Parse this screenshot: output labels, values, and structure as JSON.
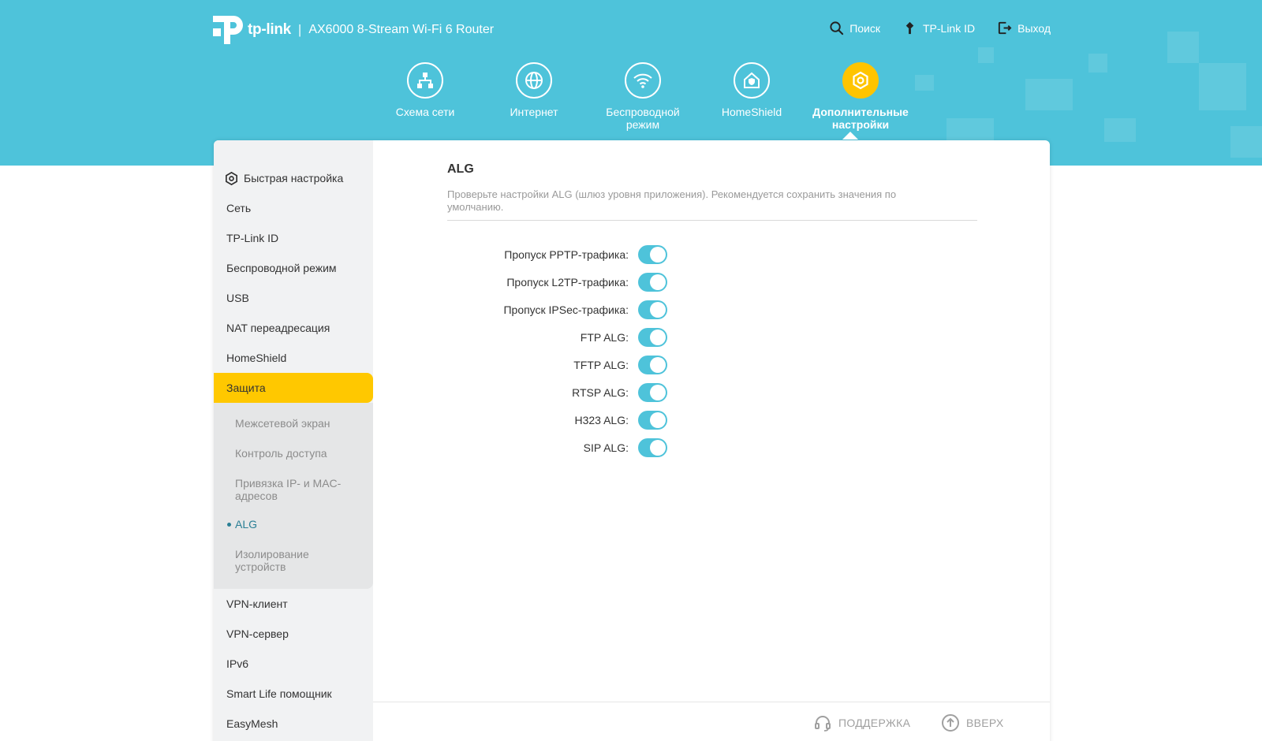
{
  "brand": {
    "logo_text": "tp-link",
    "separator": "|",
    "product": "AX6000 8-Stream Wi-Fi 6 Router"
  },
  "top_links": [
    {
      "label": "Поиск",
      "icon": "search-icon"
    },
    {
      "label": "TP-Link ID",
      "icon": "tplink-id-icon"
    },
    {
      "label": "Выход",
      "icon": "logout-icon"
    }
  ],
  "main_nav": [
    {
      "label": "Схема сети",
      "icon": "network-map-icon"
    },
    {
      "label": "Интернет",
      "icon": "globe-icon"
    },
    {
      "label": "Беспроводной режим",
      "icon": "wifi-icon"
    },
    {
      "label": "HomeShield",
      "icon": "homeshield-icon"
    },
    {
      "label": "Дополнительные настройки",
      "icon": "gear-icon",
      "active": true
    }
  ],
  "sidebar": {
    "quick_setup": "Быстрая настройка",
    "items_top": [
      "Сеть",
      "TP-Link ID",
      "Беспроводной режим",
      "USB",
      "NAT переадресация",
      "HomeShield"
    ],
    "active_item": "Защита",
    "sub_items": [
      "Межсетевой экран",
      "Контроль доступа",
      "Привязка IP- и MAC-адресов",
      "ALG",
      "Изолирование устройств"
    ],
    "current_sub": "ALG",
    "items_bottom": [
      "VPN-клиент",
      "VPN-сервер",
      "IPv6",
      "Smart Life помощник",
      "EasyMesh"
    ]
  },
  "content": {
    "title": "ALG",
    "description": "Проверьте настройки ALG (шлюз уровня приложения). Рекомендуется сохранить значения по умолчанию.",
    "toggles": [
      {
        "label": "Пропуск PPTP-трафика:",
        "enabled": true
      },
      {
        "label": "Пропуск L2TP-трафика:",
        "enabled": true
      },
      {
        "label": "Пропуск IPSec-трафика:",
        "enabled": true
      },
      {
        "label": "FTP ALG:",
        "enabled": true
      },
      {
        "label": "TFTP ALG:",
        "enabled": true
      },
      {
        "label": "RTSP ALG:",
        "enabled": true
      },
      {
        "label": "H323 ALG:",
        "enabled": true
      },
      {
        "label": "SIP ALG:",
        "enabled": true
      }
    ]
  },
  "footer": {
    "support": "ПОДДЕРЖКА",
    "top": "ВВЕРХ"
  },
  "colors": {
    "banner": "#4ec3da",
    "accent": "#ffc800",
    "toggle_on": "#4ec3da"
  }
}
